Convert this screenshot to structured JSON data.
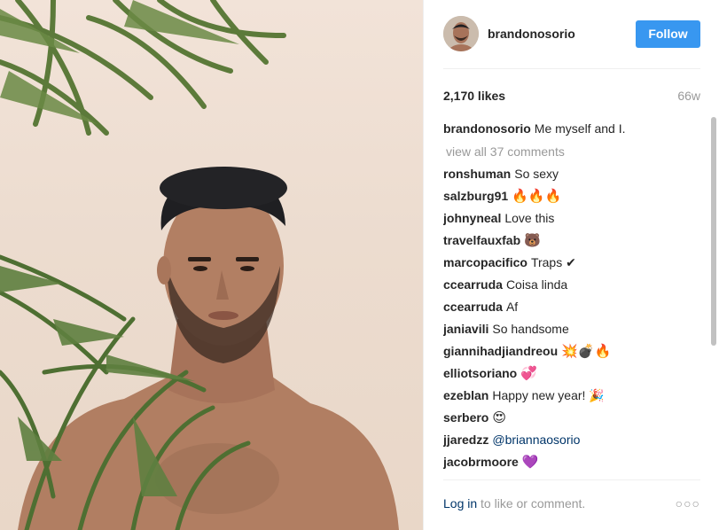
{
  "post": {
    "username": "brandonosorio",
    "follow_label": "Follow",
    "likes": "2,170 likes",
    "age": "66w",
    "caption_user": "brandonosorio",
    "caption_text": "Me myself and I.",
    "view_all": "view all 37 comments"
  },
  "comments": [
    {
      "user": "ronshuman",
      "text": "So sexy"
    },
    {
      "user": "salzburg91",
      "text": "🔥🔥🔥"
    },
    {
      "user": "johnyneal",
      "text": "Love this"
    },
    {
      "user": "travelfauxfab",
      "text": "🐻"
    },
    {
      "user": "marcopacifico",
      "text": "Traps ✔"
    },
    {
      "user": "ccearruda",
      "text": "Coisa linda"
    },
    {
      "user": "ccearruda",
      "text": "Af"
    },
    {
      "user": "janiavili",
      "text": "So handsome"
    },
    {
      "user": "giannihadjiandreou",
      "text": "💥💣🔥"
    },
    {
      "user": "elliotsoriano",
      "text": "💞"
    },
    {
      "user": "ezeblan",
      "text": "Happy new year! 🎉"
    },
    {
      "user": "serbero",
      "text": "😍"
    },
    {
      "user": "jjaredzz",
      "text": "@briannaosorio"
    },
    {
      "user": "jacobrmoore",
      "text": "💜"
    }
  ],
  "footer": {
    "login": "Log in",
    "rest": "to like or comment.",
    "more": "○○○"
  },
  "colors": {
    "accent": "#3897f0",
    "link": "#003569",
    "muted": "#999999"
  }
}
